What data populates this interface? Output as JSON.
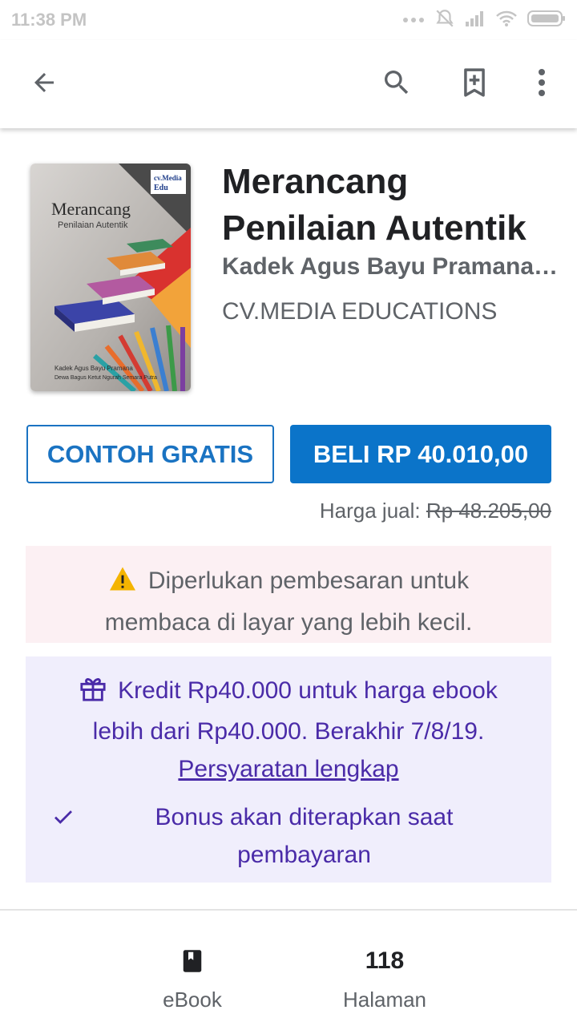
{
  "status_bar": {
    "time": "11:38 PM"
  },
  "toolbar": {
    "back_icon": "arrow-back-icon",
    "search_icon": "search-icon",
    "wishlist_icon": "bookmark-add-icon",
    "more_icon": "more-vert-icon"
  },
  "book": {
    "title": "Merancang Penilaian Autentik",
    "author": "Kadek Agus Bayu Pramana,...",
    "publisher": "CV.MEDIA EDUCATIONS",
    "cover": {
      "badge_line1": "cv.Media",
      "badge_line2": "Edu",
      "title_line1": "Merancang",
      "title_line2": "Penilaian Autentik",
      "authors_line1": "Kadek Agus Bayu Pramana",
      "authors_line2": "Dewa Bagus Ketut Ngurah Semara Putra"
    }
  },
  "actions": {
    "sample_label": "CONTOH GRATIS",
    "buy_label": "BELI RP 40.010,00"
  },
  "price": {
    "label": "Harga jual: ",
    "original": "Rp 48.205,00"
  },
  "warning": {
    "icon": "warning-icon",
    "text": "Diperlukan pembesaran untuk membaca di layar yang lebih kecil."
  },
  "promo": {
    "icon": "gift-icon",
    "text": "Kredit Rp40.000 untuk harga ebook lebih dari Rp40.000. Berakhir 7/8/19. ",
    "link": "Persyaratan lengkap",
    "check_icon": "check-icon",
    "bonus_text": "Bonus akan diterapkan saat pembayaran"
  },
  "info": {
    "format_icon": "book-icon",
    "format_label": "eBook",
    "pages_value": "118",
    "pages_label": "Halaman"
  },
  "colors": {
    "accent": "#0b74c9",
    "promo_text": "#4a2ba8",
    "promo_bg": "#f0eefc",
    "warning_bg": "#fcf0f3",
    "warning_icon": "#f4b400"
  }
}
